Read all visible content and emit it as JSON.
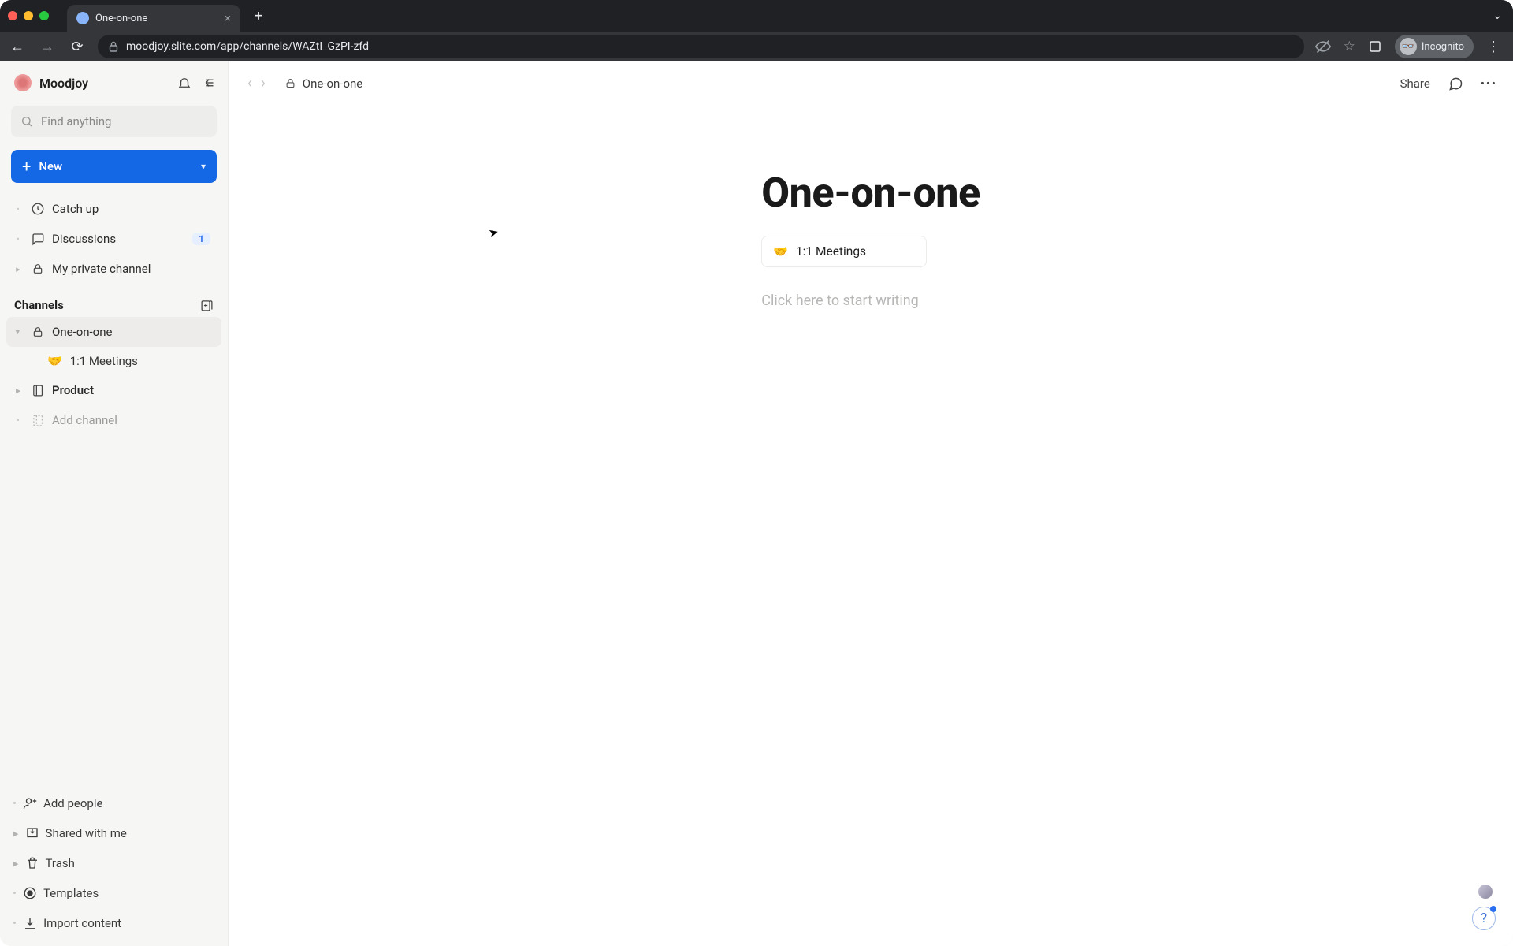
{
  "browser": {
    "tab_title": "One-on-one",
    "url_display": "moodjoy.slite.com/app/channels/WAZtI_GzPI-zfd",
    "incognito_label": "Incognito"
  },
  "workspace": {
    "name": "Moodjoy"
  },
  "search": {
    "placeholder": "Find anything"
  },
  "new_button": {
    "label": "New"
  },
  "nav": {
    "catch_up": "Catch up",
    "discussions": "Discussions",
    "discussions_badge": "1",
    "private_channel": "My private channel"
  },
  "channels_section": {
    "label": "Channels",
    "items": {
      "one_on_one": "One-on-one",
      "one_on_one_child": "1:1 Meetings",
      "product": "Product",
      "add_channel": "Add channel"
    }
  },
  "footer": {
    "add_people": "Add people",
    "shared": "Shared with me",
    "trash": "Trash",
    "templates": "Templates",
    "import": "Import content"
  },
  "topbar": {
    "breadcrumb": "One-on-one",
    "share": "Share"
  },
  "document": {
    "title": "One-on-one",
    "linked_page": "1:1 Meetings",
    "linked_emoji": "🤝",
    "placeholder": "Click here to start writing"
  }
}
